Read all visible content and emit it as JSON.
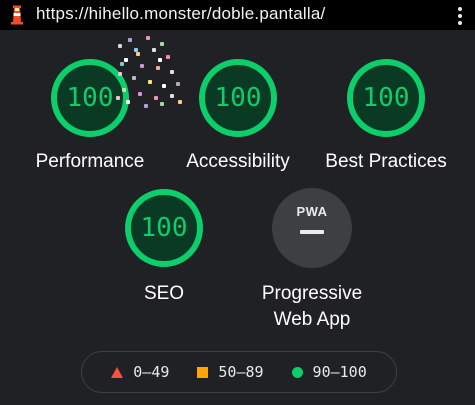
{
  "url_bar": {
    "url": "https://hihello.monster/doble.pantalla/",
    "logo_icon": "lighthouse-icon",
    "menu_icon": "more-vert-icon"
  },
  "gauges": [
    {
      "id": "performance",
      "score": "100",
      "label": "Performance"
    },
    {
      "id": "accessibility",
      "score": "100",
      "label": "Accessibility"
    },
    {
      "id": "best-practices",
      "score": "100",
      "label": "Best Practices"
    },
    {
      "id": "seo",
      "score": "100",
      "label": "SEO"
    }
  ],
  "pwa": {
    "badge_text": "PWA",
    "label_line1": "Progressive",
    "label_line2": "Web App"
  },
  "legend": [
    {
      "range": "0–49",
      "icon": "fail-triangle-icon",
      "color": "#ff4e42"
    },
    {
      "range": "50–89",
      "icon": "average-square-icon",
      "color": "#ffa400"
    },
    {
      "range": "90–100",
      "icon": "pass-circle-icon",
      "color": "#0cce6b"
    }
  ],
  "colors": {
    "background": "#202124",
    "pass": "#0cce6b",
    "average": "#ffa400",
    "fail": "#ff4e42",
    "label": "#ffffff"
  }
}
